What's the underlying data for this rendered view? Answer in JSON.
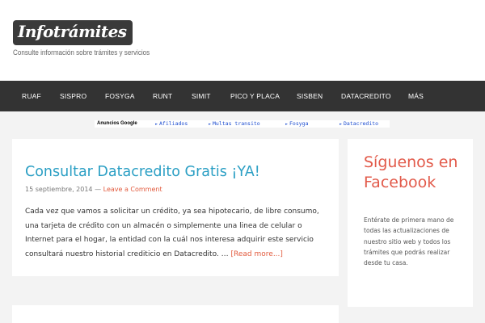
{
  "header": {
    "logo": "Infotrámites",
    "tagline": "Consulte información sobre trámites y servicios"
  },
  "nav": {
    "items": [
      "RUAF",
      "SISPRO",
      "FOSYGA",
      "RUNT",
      "SIMIT",
      "PICO Y PLACA",
      "SISBEN",
      "DATACREDITO",
      "MÁS"
    ]
  },
  "ads": {
    "label": "Anuncios Google",
    "links": [
      "Afiliados",
      "Multas transito",
      "Fosyga",
      "Datacredito"
    ]
  },
  "post": {
    "title": "Consultar Datacredito Gratis ¡YA!",
    "date": "15 septiembre, 2014",
    "separator": " — ",
    "comment_link": "Leave a Comment",
    "excerpt": "Cada vez que vamos a solicitar un crédito, ya sea hipotecario, de libre consumo, una tarjeta de crédito con un almacén o simplemente una linea de celular o Internet para el hogar, la entidad con la cuál nos interesa adquirir este servicio consultará nuestro historial crediticio en Datacredito. … ",
    "read_more": "[Read more...]"
  },
  "sidebar": {
    "title": "Síguenos en Facebook",
    "text": "Entérate de primera mano de todas las actualizaciones de nuestro sitio web y todos los trámites que podrás realizar desde tu casa."
  },
  "colors": {
    "nav_bg": "#333333",
    "page_bg": "#f3f3f3",
    "title_blue": "#2b9fc4",
    "accent_red": "#e25a3d"
  }
}
